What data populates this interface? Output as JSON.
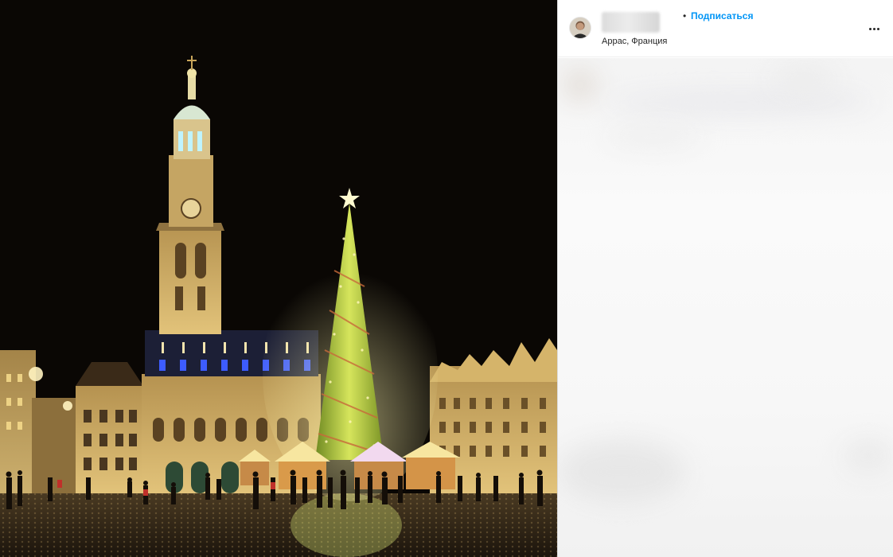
{
  "header": {
    "separator": "•",
    "follow_label": "Подписаться",
    "location": "Аррас, Франция",
    "more_icon": "more-horizontal-icon"
  },
  "photo": {
    "subject": "night-square-christmas-tree"
  },
  "colors": {
    "follow_blue": "#0095f6",
    "text_dark": "#262626",
    "sky": "#0a0704",
    "facade_gold": "#c9a55a",
    "tree_green": "#a8c43a"
  }
}
